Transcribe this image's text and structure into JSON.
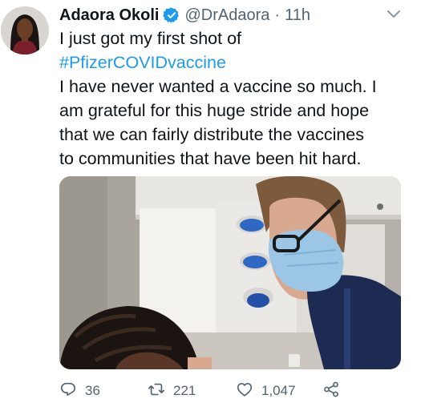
{
  "tweet": {
    "author": {
      "name": "Adaora Okoli",
      "handle": "@DrAdaora",
      "separator": "·",
      "time": "11h",
      "verified": true,
      "avatar_icon": "profile-photo"
    },
    "text_lines": [
      "I just got my first shot of",
      "#PfizerCOVIDvaccine",
      "I have never wanted a vaccine so much. I",
      "am grateful for this huge stride and hope",
      "that we can fairly distribute the vaccines",
      "to communities that have been hit hard."
    ],
    "hashtag": "#PfizerCOVIDvaccine",
    "media": {
      "type": "photo"
    },
    "actions": {
      "replies": "36",
      "retweets": "221",
      "likes": "1,047"
    }
  },
  "colors": {
    "text": "#0f1419",
    "secondary": "#536471",
    "accent": "#1d9bf0",
    "verified": "#1d9bf0"
  },
  "icons": {
    "verified": "verified-badge-icon",
    "menu": "chevron-down-icon",
    "reply": "reply-icon",
    "retweet": "retweet-icon",
    "like": "heart-icon",
    "share": "share-icon"
  }
}
